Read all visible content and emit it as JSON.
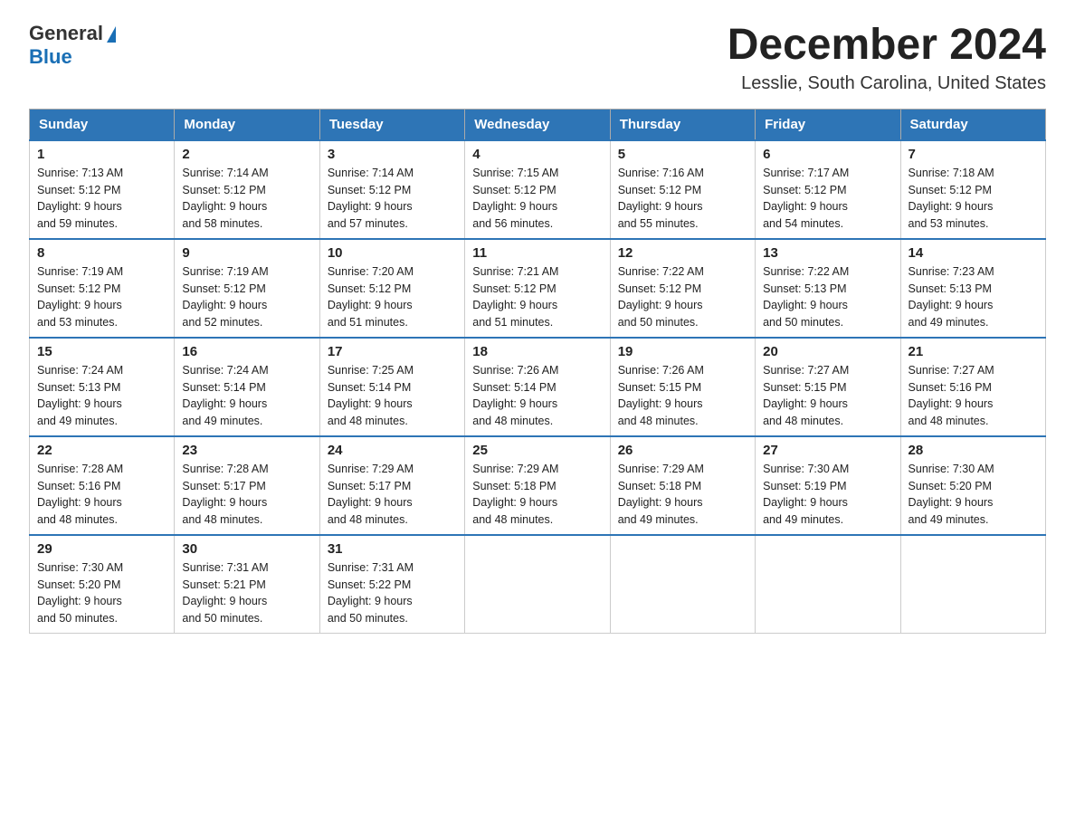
{
  "logo": {
    "general": "General",
    "blue": "Blue"
  },
  "title": "December 2024",
  "subtitle": "Lesslie, South Carolina, United States",
  "weekdays": [
    "Sunday",
    "Monday",
    "Tuesday",
    "Wednesday",
    "Thursday",
    "Friday",
    "Saturday"
  ],
  "weeks": [
    [
      {
        "day": "1",
        "sunrise": "7:13 AM",
        "sunset": "5:12 PM",
        "daylight": "9 hours and 59 minutes."
      },
      {
        "day": "2",
        "sunrise": "7:14 AM",
        "sunset": "5:12 PM",
        "daylight": "9 hours and 58 minutes."
      },
      {
        "day": "3",
        "sunrise": "7:14 AM",
        "sunset": "5:12 PM",
        "daylight": "9 hours and 57 minutes."
      },
      {
        "day": "4",
        "sunrise": "7:15 AM",
        "sunset": "5:12 PM",
        "daylight": "9 hours and 56 minutes."
      },
      {
        "day": "5",
        "sunrise": "7:16 AM",
        "sunset": "5:12 PM",
        "daylight": "9 hours and 55 minutes."
      },
      {
        "day": "6",
        "sunrise": "7:17 AM",
        "sunset": "5:12 PM",
        "daylight": "9 hours and 54 minutes."
      },
      {
        "day": "7",
        "sunrise": "7:18 AM",
        "sunset": "5:12 PM",
        "daylight": "9 hours and 53 minutes."
      }
    ],
    [
      {
        "day": "8",
        "sunrise": "7:19 AM",
        "sunset": "5:12 PM",
        "daylight": "9 hours and 53 minutes."
      },
      {
        "day": "9",
        "sunrise": "7:19 AM",
        "sunset": "5:12 PM",
        "daylight": "9 hours and 52 minutes."
      },
      {
        "day": "10",
        "sunrise": "7:20 AM",
        "sunset": "5:12 PM",
        "daylight": "9 hours and 51 minutes."
      },
      {
        "day": "11",
        "sunrise": "7:21 AM",
        "sunset": "5:12 PM",
        "daylight": "9 hours and 51 minutes."
      },
      {
        "day": "12",
        "sunrise": "7:22 AM",
        "sunset": "5:12 PM",
        "daylight": "9 hours and 50 minutes."
      },
      {
        "day": "13",
        "sunrise": "7:22 AM",
        "sunset": "5:13 PM",
        "daylight": "9 hours and 50 minutes."
      },
      {
        "day": "14",
        "sunrise": "7:23 AM",
        "sunset": "5:13 PM",
        "daylight": "9 hours and 49 minutes."
      }
    ],
    [
      {
        "day": "15",
        "sunrise": "7:24 AM",
        "sunset": "5:13 PM",
        "daylight": "9 hours and 49 minutes."
      },
      {
        "day": "16",
        "sunrise": "7:24 AM",
        "sunset": "5:14 PM",
        "daylight": "9 hours and 49 minutes."
      },
      {
        "day": "17",
        "sunrise": "7:25 AM",
        "sunset": "5:14 PM",
        "daylight": "9 hours and 48 minutes."
      },
      {
        "day": "18",
        "sunrise": "7:26 AM",
        "sunset": "5:14 PM",
        "daylight": "9 hours and 48 minutes."
      },
      {
        "day": "19",
        "sunrise": "7:26 AM",
        "sunset": "5:15 PM",
        "daylight": "9 hours and 48 minutes."
      },
      {
        "day": "20",
        "sunrise": "7:27 AM",
        "sunset": "5:15 PM",
        "daylight": "9 hours and 48 minutes."
      },
      {
        "day": "21",
        "sunrise": "7:27 AM",
        "sunset": "5:16 PM",
        "daylight": "9 hours and 48 minutes."
      }
    ],
    [
      {
        "day": "22",
        "sunrise": "7:28 AM",
        "sunset": "5:16 PM",
        "daylight": "9 hours and 48 minutes."
      },
      {
        "day": "23",
        "sunrise": "7:28 AM",
        "sunset": "5:17 PM",
        "daylight": "9 hours and 48 minutes."
      },
      {
        "day": "24",
        "sunrise": "7:29 AM",
        "sunset": "5:17 PM",
        "daylight": "9 hours and 48 minutes."
      },
      {
        "day": "25",
        "sunrise": "7:29 AM",
        "sunset": "5:18 PM",
        "daylight": "9 hours and 48 minutes."
      },
      {
        "day": "26",
        "sunrise": "7:29 AM",
        "sunset": "5:18 PM",
        "daylight": "9 hours and 49 minutes."
      },
      {
        "day": "27",
        "sunrise": "7:30 AM",
        "sunset": "5:19 PM",
        "daylight": "9 hours and 49 minutes."
      },
      {
        "day": "28",
        "sunrise": "7:30 AM",
        "sunset": "5:20 PM",
        "daylight": "9 hours and 49 minutes."
      }
    ],
    [
      {
        "day": "29",
        "sunrise": "7:30 AM",
        "sunset": "5:20 PM",
        "daylight": "9 hours and 50 minutes."
      },
      {
        "day": "30",
        "sunrise": "7:31 AM",
        "sunset": "5:21 PM",
        "daylight": "9 hours and 50 minutes."
      },
      {
        "day": "31",
        "sunrise": "7:31 AM",
        "sunset": "5:22 PM",
        "daylight": "9 hours and 50 minutes."
      },
      null,
      null,
      null,
      null
    ]
  ],
  "labels": {
    "sunrise": "Sunrise:",
    "sunset": "Sunset:",
    "daylight": "Daylight:"
  }
}
